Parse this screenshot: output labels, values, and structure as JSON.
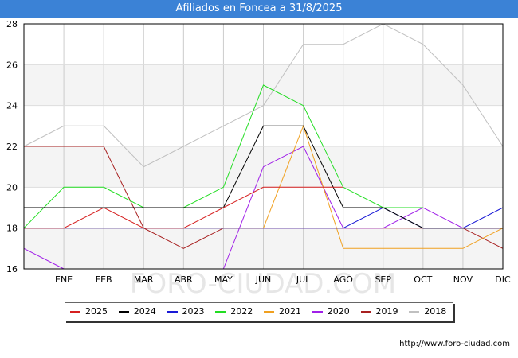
{
  "title": "Afiliados en Foncea a 31/8/2025",
  "source": "http://www.foro-ciudad.com",
  "watermark": "FORO-CIUDAD.COM",
  "chart_data": {
    "type": "line",
    "categories": [
      "",
      "ENE",
      "FEB",
      "MAR",
      "ABR",
      "MAY",
      "JUN",
      "JUL",
      "AGO",
      "SEP",
      "OCT",
      "NOV",
      "DIC"
    ],
    "ylim": [
      16,
      28
    ],
    "yticks": [
      "16",
      "18",
      "20",
      "22",
      "24",
      "26",
      "28"
    ],
    "grid": true,
    "legend_placement": "bottom",
    "series": [
      {
        "name": "2025",
        "color": "#d62020",
        "values": [
          18,
          18,
          19,
          18,
          18,
          19,
          20,
          20,
          20,
          null,
          null,
          null,
          null
        ]
      },
      {
        "name": "2024",
        "color": "#000000",
        "values": [
          19,
          19,
          19,
          19,
          19,
          19,
          23,
          23,
          19,
          19,
          18,
          18,
          18
        ]
      },
      {
        "name": "2023",
        "color": "#1a1ad6",
        "values": [
          18,
          18,
          18,
          18,
          18,
          18,
          18,
          18,
          18,
          19,
          18,
          18,
          19
        ]
      },
      {
        "name": "2022",
        "color": "#22dd22",
        "values": [
          18,
          20,
          20,
          19,
          19,
          20,
          25,
          24,
          20,
          19,
          19,
          null,
          null
        ]
      },
      {
        "name": "2021",
        "color": "#f0a020",
        "values": [
          18,
          18,
          18,
          18,
          18,
          18,
          18,
          23,
          17,
          17,
          17,
          17,
          18
        ]
      },
      {
        "name": "2020",
        "color": "#a020e8",
        "values": [
          17,
          16,
          null,
          null,
          null,
          16,
          21,
          22,
          18,
          18,
          19,
          18,
          18
        ]
      },
      {
        "name": "2019",
        "color": "#a82020",
        "values": [
          22,
          22,
          22,
          18,
          17,
          18,
          18,
          18,
          18,
          18,
          18,
          18,
          17
        ]
      },
      {
        "name": "2018",
        "color": "#c0c0c0",
        "values": [
          22,
          23,
          23,
          21,
          22,
          23,
          24,
          27,
          27,
          28,
          27,
          25,
          22
        ]
      }
    ]
  }
}
